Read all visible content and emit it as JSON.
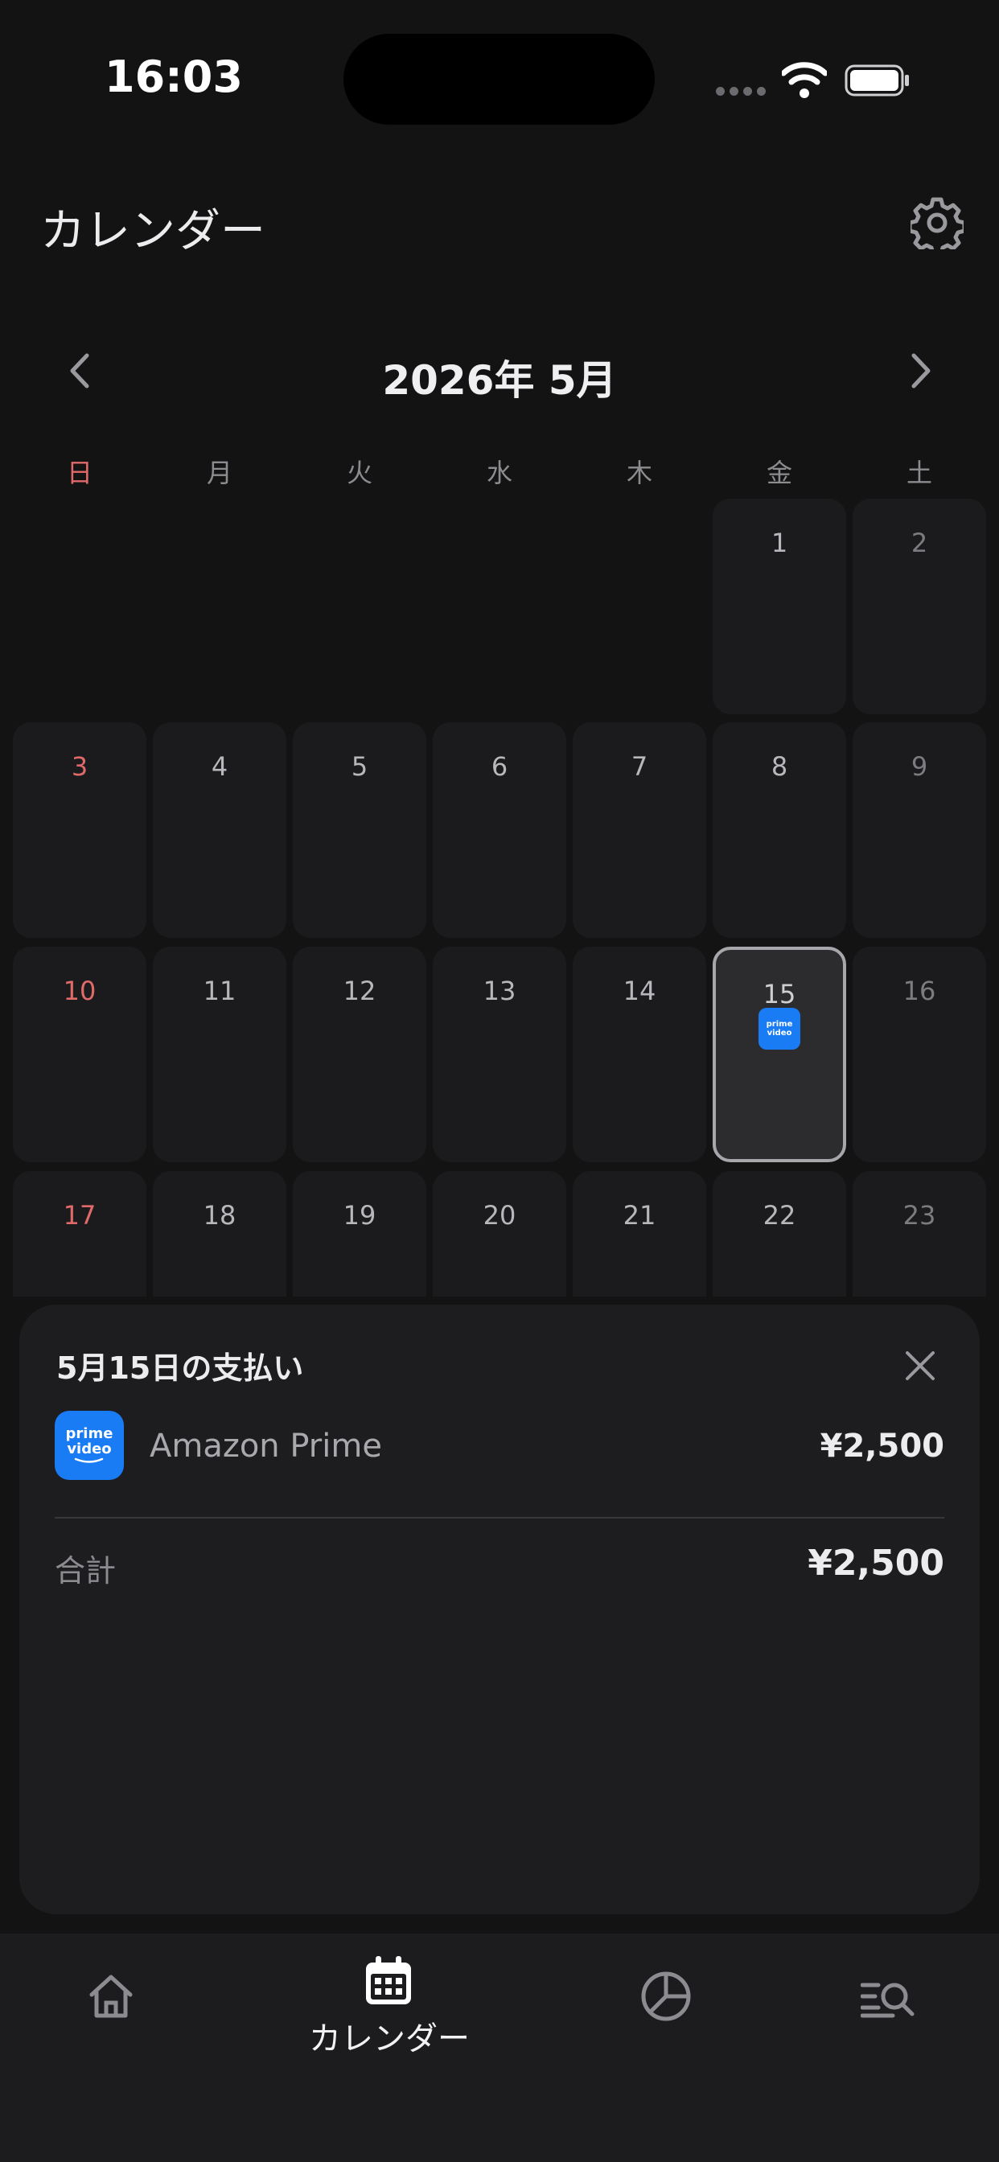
{
  "status": {
    "time": "16:03"
  },
  "header": {
    "title": "カレンダー"
  },
  "calendar": {
    "month_title": "2026年 5月",
    "weekdays": [
      "日",
      "月",
      "火",
      "水",
      "木",
      "金",
      "土"
    ],
    "days": [
      "1",
      "2",
      "3",
      "4",
      "5",
      "6",
      "7",
      "8",
      "9",
      "10",
      "11",
      "12",
      "13",
      "14",
      "15",
      "16",
      "17",
      "18",
      "19",
      "20",
      "21",
      "22",
      "23"
    ],
    "selected_day": "15",
    "event_icon": "prime-video-icon"
  },
  "sheet": {
    "title": "5月15日の支払い",
    "item": {
      "name": "Amazon Prime",
      "price": "¥2,500",
      "icon_text_1": "prime",
      "icon_text_2": "video"
    },
    "total_label": "合計",
    "total_value": "¥2,500"
  },
  "tabbar": {
    "items": [
      "home-icon",
      "calendar-icon",
      "pie-chart-icon",
      "search-list-icon"
    ],
    "active_label": "カレンダー"
  },
  "colors": {
    "background": "#131314",
    "accent": "#1a7cf5",
    "sunday": "#e06a6a"
  }
}
